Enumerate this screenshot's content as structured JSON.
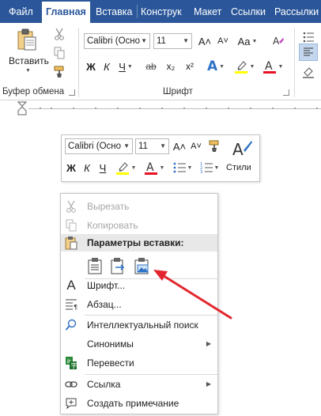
{
  "tabs": [
    "Файл",
    "Главная",
    "Вставка",
    "Конструк",
    "Макет",
    "Ссылки",
    "Рассылки"
  ],
  "ribbon": {
    "clipboard": {
      "paste_label": "Вставить",
      "group_label": "Буфер обмена"
    },
    "font": {
      "font_name": "Calibri (Осно",
      "font_size": "11",
      "grow": "A˄",
      "shrink": "A˅",
      "case": "Aa",
      "bold": "Ж",
      "italic": "К",
      "underline": "Ч",
      "strike": "ab",
      "subscript": "x₂",
      "superscript": "x²",
      "effects": "A",
      "highlight": "ab",
      "color": "A",
      "group_label": "Шрифт"
    }
  },
  "mini_toolbar": {
    "font_name": "Calibri (Осно",
    "font_size": "11",
    "grow": "A˄",
    "shrink": "A˅",
    "bold": "Ж",
    "italic": "К",
    "underline": "Ч",
    "color_letter": "A",
    "styles_label": "Стили"
  },
  "context_menu": {
    "cut": "Вырезать",
    "copy": "Копировать",
    "paste_options_header": "Параметры вставки:",
    "font": "Шрифт...",
    "paragraph": "Абзац...",
    "smart_lookup": "Интеллектуальный поиск",
    "synonyms": "Синонимы",
    "translate": "Перевести",
    "link": "Ссылка",
    "new_comment": "Создать примечание"
  },
  "colors": {
    "tab_bar": "#2b579a",
    "highlight_yellow": "#ffff00",
    "font_red": "#e81123",
    "arrow_red": "#e3262e",
    "effects_blue": "#2f73c6"
  }
}
